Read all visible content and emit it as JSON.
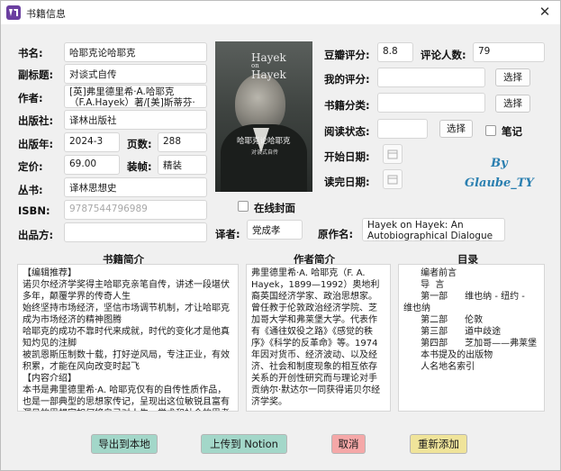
{
  "window": {
    "title": "书籍信息",
    "close_glyph": "✕"
  },
  "labels": {
    "title": "书名:",
    "subtitle": "副标题:",
    "author": "作者:",
    "publisher": "出版社:",
    "pub_year": "出版年:",
    "pages": "页数:",
    "price": "定价:",
    "binding": "装帧:",
    "series": "丛书:",
    "isbn": "ISBN:",
    "producer": "出品方:",
    "translator": "译者:",
    "original_title": "原作名:",
    "douban_rating": "豆瓣评分:",
    "review_count": "评论人数:",
    "my_rating": "我的评分:",
    "category": "书籍分类:",
    "reading_status": "阅读状态:",
    "notes": "笔记",
    "start_date": "开始日期:",
    "end_date": "读完日期:",
    "online_cover": "在线封面"
  },
  "values": {
    "title": "哈耶克论哈耶克",
    "subtitle": "对谈式自传",
    "author": "[英]弗里德里希·A.哈耶克（F.A.Hayek）著/[美]斯蒂芬·克雷",
    "publisher": "译林出版社",
    "pub_year": "2024-3",
    "pages": "288",
    "price": "69.00",
    "binding": "精装",
    "series": "译林思想史",
    "isbn_placeholder": "9787544796989",
    "producer": "",
    "translator": "党成孝",
    "original_title": "Hayek on Hayek: An Autobiographical Dialogue",
    "douban_rating": "8.8",
    "review_count": "79",
    "my_rating": "",
    "category": "",
    "reading_status": ""
  },
  "buttons": {
    "select_rating": "选择",
    "select_category": "选择",
    "select_status": "选择",
    "export": "导出到本地",
    "upload": "上传到 Notion",
    "cancel": "取消",
    "re_add": "重新添加"
  },
  "cover": {
    "title_line1": "Hayek",
    "title_line2": "on",
    "title_line3": "Hayek",
    "cn_title": "哈耶克论哈耶克",
    "cn_sub": "对谈式自传"
  },
  "signature": {
    "line1": "By",
    "line2": "Glaube_TY"
  },
  "sections": {
    "summary_title": "书籍简介",
    "author_title": "作者简介",
    "toc_title": "目录"
  },
  "summary": [
    "【编辑推荐】",
    "诺贝尔经济学奖得主哈耶克亲笔自传，讲述一段堪伏多年，颠覆学界的传奇人生",
    "始终坚持市场经济，坚信市场调节机制，才让哈耶克成为市场经济的精神图腾",
    "哈耶克的成功不靠时代来成就，时代的变化才是他真知灼见的注脚",
    "被凯恩斯压制数十载，打好逆风局，专注正业，有效积累，才能在风向改变时起飞",
    "【内容介绍】",
    "本书是弗里德里希·A. 哈耶克仅有的自传性质作品，也是一部典型的思想家传记，呈现出这位敏锐且富有洞见的思想家如何将自己对人生、学术和社会的思考与"
  ],
  "author_bio": "弗里德里希·A. 哈耶克（F. A. Hayek，1899—1992）奥地利裔英国经济学家、政治思想家。曾任教于伦敦政治经济学院、芝加哥大学和弗莱堡大学。代表作有《通往奴役之路》《感觉的秩序》《科学的反革命》等。1974年因对货币、经济波动、以及经济、社会和制度现象的相互依存关系的开创性研究而与理论对手贡纳尔·默达尔一同获得诺贝尔经济学奖。",
  "toc": [
    "",
    "      编者前言",
    "      导  言",
    "      第一部      维也纳 - 纽约 - ",
    "维也纳",
    "",
    "      第二部      伦敦",
    "      第三部      道中歧途",
    "      第四部      芝加哥——弗莱堡",
    "      本书提及的出版物",
    "      人名地名索引"
  ]
}
